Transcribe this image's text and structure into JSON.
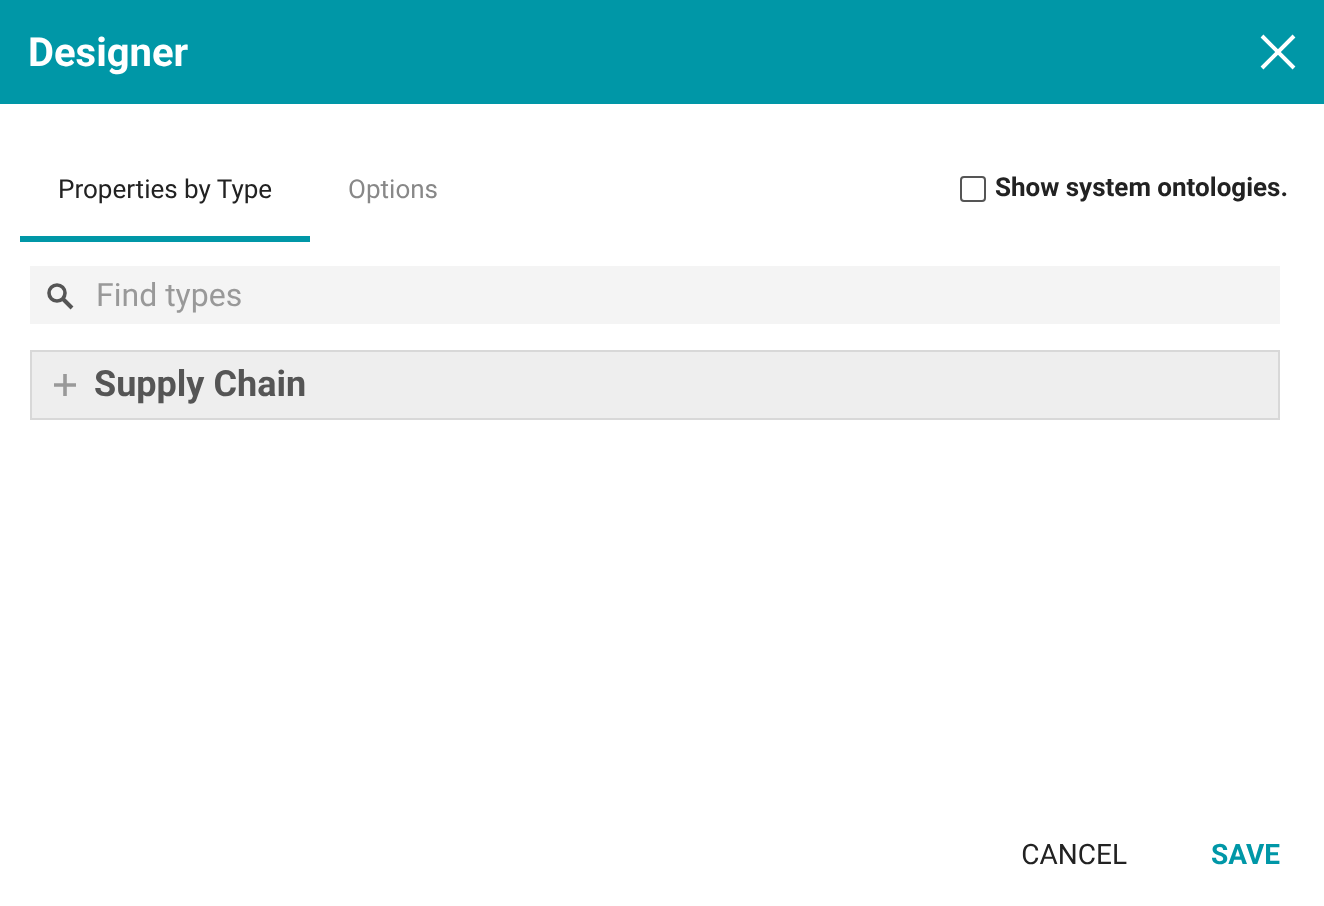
{
  "window": {
    "title": "Designer"
  },
  "tabs": [
    {
      "label": "Properties by Type",
      "selected": true
    },
    {
      "label": "Options",
      "selected": false
    }
  ],
  "show_system_ontologies": {
    "label": "Show system ontologies.",
    "checked": false
  },
  "search": {
    "placeholder": "Find types"
  },
  "tree": [
    {
      "label": "Supply Chain",
      "expanded": false
    }
  ],
  "buttons": [
    {
      "label": "CANCEL",
      "kind": "secondary"
    },
    {
      "label": "SAVE",
      "kind": "primary"
    }
  ]
}
